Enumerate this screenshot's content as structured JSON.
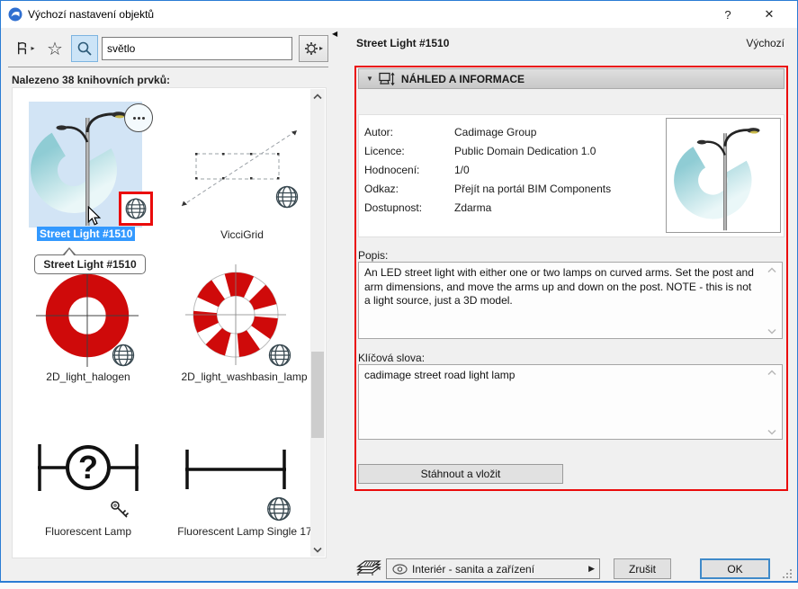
{
  "window": {
    "title": "Výchozí nastavení objektů",
    "help_label": "?",
    "close_label": "✕"
  },
  "search": {
    "query": "světlo",
    "results_label": "Nalezeno 38 knihovních prvků:"
  },
  "library": {
    "items": [
      {
        "label": "Street Light #1510",
        "badge": "globe-icon",
        "selected": true
      },
      {
        "label": "VicciGrid",
        "badge": "globe-icon",
        "selected": false
      },
      {
        "label": "2D_light_halogen",
        "badge": "globe-icon",
        "selected": false
      },
      {
        "label": "2D_light_washbasin_lamp",
        "badge": "globe-icon",
        "selected": false
      },
      {
        "label": "Fluorescent Lamp",
        "badge": "key-icon",
        "selected": false
      },
      {
        "label": "Fluorescent Lamp Single 17",
        "badge": "globe-icon",
        "selected": false
      }
    ],
    "tooltip": "Street Light #1510"
  },
  "details": {
    "title": "Street Light #1510",
    "state_label": "Výchozí",
    "section_title": "NÁHLED A INFORMACE",
    "fields": [
      {
        "label": "Autor:",
        "value": "Cadimage Group"
      },
      {
        "label": "Licence:",
        "value": "Public Domain Dedication 1.0"
      },
      {
        "label": "Hodnocení:",
        "value": "1/0"
      },
      {
        "label": "Odkaz:",
        "value": "Přejít na portál BIM Components"
      },
      {
        "label": "Dostupnost:",
        "value": "Zdarma"
      }
    ],
    "description_label": "Popis:",
    "description": "An LED street light with either one or two lamps on curved arms. Set the post and arm dimensions, and move the arms up and down on the post. NOTE - this is not a light source, just a 3D model.",
    "keywords_label": "Klíčová slova:",
    "keywords": "cadimage street road light lamp",
    "download_button": "Stáhnout a vložit"
  },
  "footer": {
    "layer_combo": "Interiér - sanita a zařízení",
    "cancel_button": "Zrušit",
    "ok_button": "OK"
  },
  "icons": {
    "collapse_triangle": "▼",
    "panel_collapse": "◀",
    "combo_arrow": "▶",
    "small_arrow": "▸",
    "star": "☆"
  },
  "colors": {
    "accent_blue": "#2a7cd4",
    "selection_blue": "#3399ff",
    "highlight_red": "#ea0b0b",
    "thumbnail_blue": "#d2e4f5",
    "brand_teal": "#8fccd4"
  }
}
